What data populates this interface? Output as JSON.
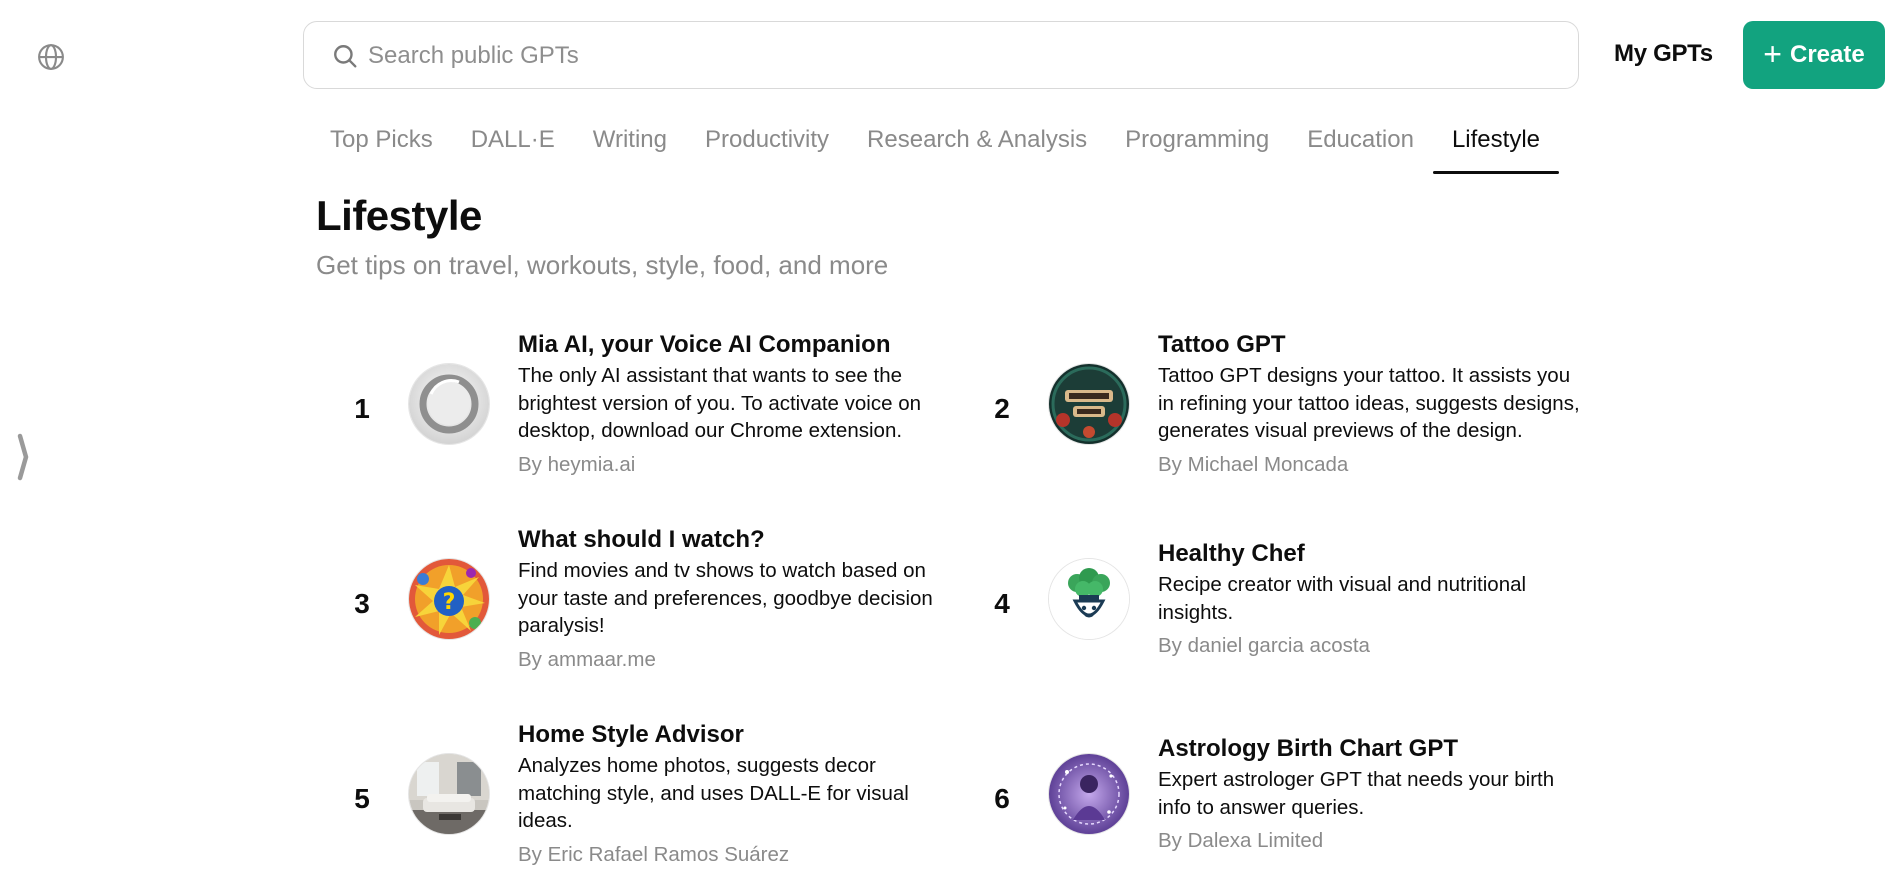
{
  "search": {
    "placeholder": "Search public GPTs",
    "value": ""
  },
  "header": {
    "my_gpts_label": "My GPTs",
    "create_label": "Create",
    "create_color": "#12a37f"
  },
  "tabs": [
    {
      "label": "Top Picks",
      "active": false
    },
    {
      "label": "DALL·E",
      "active": false
    },
    {
      "label": "Writing",
      "active": false
    },
    {
      "label": "Productivity",
      "active": false
    },
    {
      "label": "Research & Analysis",
      "active": false
    },
    {
      "label": "Programming",
      "active": false
    },
    {
      "label": "Education",
      "active": false
    },
    {
      "label": "Lifestyle",
      "active": true
    }
  ],
  "section": {
    "title": "Lifestyle",
    "subtitle": "Get tips on travel, workouts, style, food, and more"
  },
  "gpts": [
    {
      "rank": "1",
      "name": "Mia AI, your Voice AI Companion",
      "description": "The only AI assistant that wants to see the brightest version of you. To activate voice on desktop, download our Chrome extension.",
      "author": "By heymia.ai",
      "icon": "mia-ring-icon"
    },
    {
      "rank": "2",
      "name": "Tattoo GPT",
      "description": "Tattoo GPT designs your tattoo. It assists you in refining your tattoo ideas, suggests designs, generates visual previews of the design.",
      "author": "By Michael Moncada",
      "icon": "tattoo-gpt-icon"
    },
    {
      "rank": "3",
      "name": "What should I watch?",
      "description": "Find movies and tv shows to watch based on your taste and preferences, goodbye decision paralysis!",
      "author": "By ammaar.me",
      "icon": "question-mark-burst-icon"
    },
    {
      "rank": "4",
      "name": "Healthy Chef",
      "description": "Recipe creator with visual and nutritional insights.",
      "author": "By daniel garcia acosta",
      "icon": "broccoli-chef-icon"
    },
    {
      "rank": "5",
      "name": "Home Style Advisor",
      "description": "Analyzes home photos, suggests decor matching style, and uses DALL-E for visual ideas.",
      "author": "By Eric Rafael Ramos Suárez",
      "icon": "living-room-icon"
    },
    {
      "rank": "6",
      "name": "Astrology Birth Chart GPT",
      "description": "Expert astrologer GPT that needs your birth info to answer queries.",
      "author": "By Dalexa Limited",
      "icon": "astrologer-icon"
    }
  ]
}
